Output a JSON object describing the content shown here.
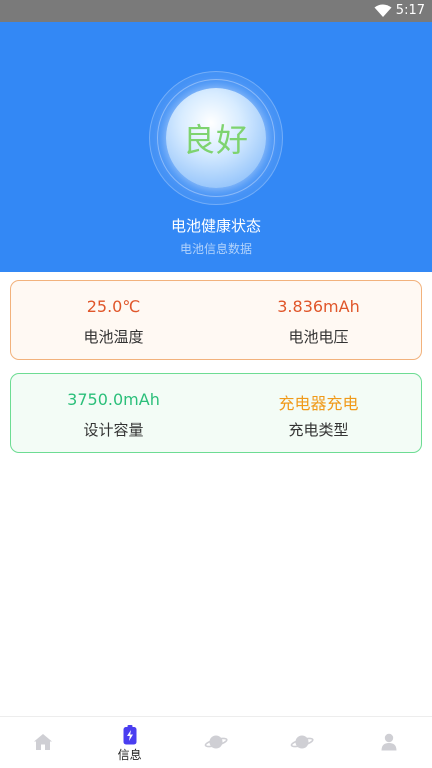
{
  "status_bar": {
    "time": "5:17"
  },
  "health": {
    "status": "良好",
    "title": "电池健康状态",
    "subtitle": "电池信息数据"
  },
  "cards": [
    {
      "left": {
        "value": "25.0℃",
        "label": "电池温度",
        "color": "#e0562a"
      },
      "right": {
        "value": "3.836mAh",
        "label": "电池电压",
        "color": "#e0562a"
      }
    },
    {
      "left": {
        "value": "3750.0mAh",
        "label": "设计容量",
        "color": "#2bbf7a"
      },
      "right": {
        "value": "充电器充电",
        "label": "充电类型",
        "color": "#f09a1a"
      }
    }
  ],
  "bottom_nav": {
    "items": [
      {
        "icon": "home-icon",
        "label": ""
      },
      {
        "icon": "battery-icon",
        "label": "信息",
        "active": true
      },
      {
        "icon": "planet-icon",
        "label": ""
      },
      {
        "icon": "planet-icon",
        "label": ""
      },
      {
        "icon": "user-icon",
        "label": ""
      }
    ]
  },
  "colors": {
    "header_bg": "#3388f5",
    "active_nav": "#4a3ef0",
    "inactive_nav": "#cfcfd4"
  }
}
